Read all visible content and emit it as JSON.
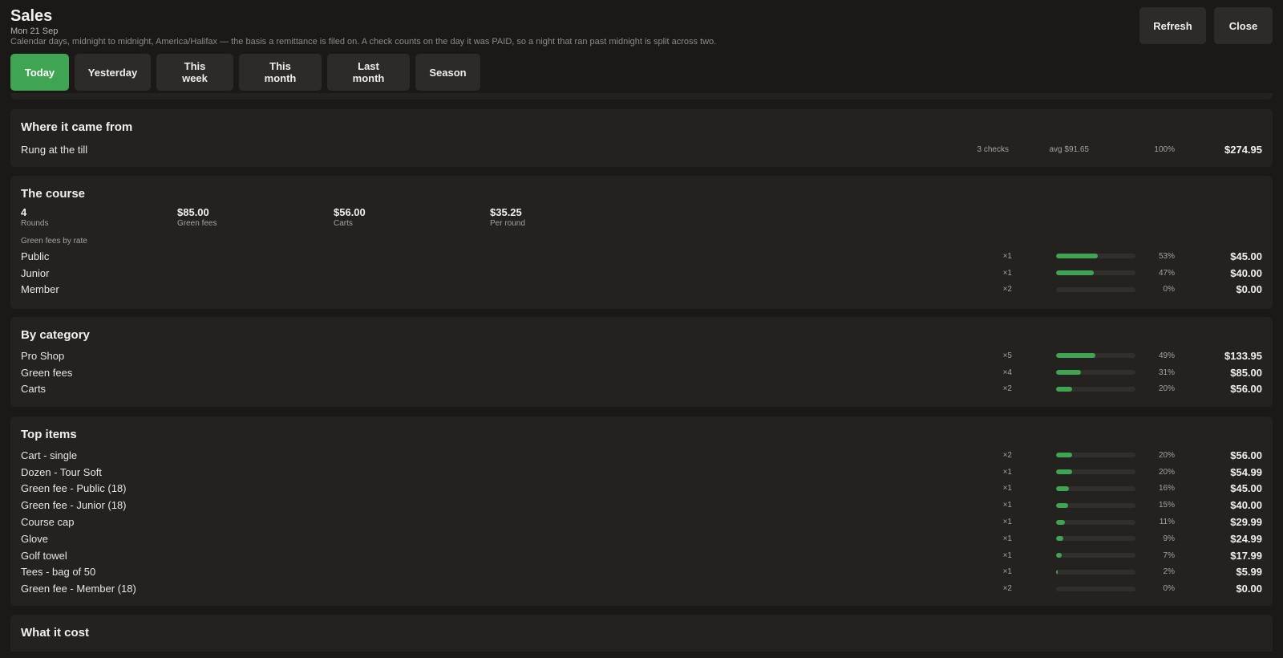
{
  "header": {
    "title": "Sales",
    "date": "Mon 21 Sep",
    "basis": "Calendar days, midnight to midnight, America/Halifax — the basis a remittance is filed on. A check counts on the day it was PAID, so a night that ran past midnight is split across two.",
    "refresh_label": "Refresh",
    "close_label": "Close"
  },
  "tabs": [
    {
      "label": "Today",
      "active": true
    },
    {
      "label": "Yesterday"
    },
    {
      "label": "This week"
    },
    {
      "label": "This month"
    },
    {
      "label": "Last month"
    },
    {
      "label": "Season"
    }
  ],
  "colors": {
    "accent": "#3fa553",
    "background": "#1a1917",
    "card": "#23221f"
  },
  "source": {
    "title": "Where it came from",
    "rows": [
      {
        "label": "Rung at the till",
        "checks": "3 checks",
        "avg": "avg $91.65",
        "pct": "100%",
        "amount": "$274.95"
      }
    ]
  },
  "course": {
    "title": "The course",
    "stats": [
      {
        "value": "4",
        "label": "Rounds"
      },
      {
        "value": "$85.00",
        "label": "Green fees"
      },
      {
        "value": "$56.00",
        "label": "Carts"
      },
      {
        "value": "$35.25",
        "label": "Per round"
      }
    ],
    "subtitle": "Green fees by rate",
    "rows": [
      {
        "label": "Public",
        "count": "×1",
        "share": 0.53,
        "pct": "53%",
        "amount": "$45.00"
      },
      {
        "label": "Junior",
        "count": "×1",
        "share": 0.47,
        "pct": "47%",
        "amount": "$40.00"
      },
      {
        "label": "Member",
        "count": "×2",
        "share": 0,
        "pct": "0%",
        "amount": "$0.00"
      }
    ]
  },
  "category": {
    "title": "By category",
    "rows": [
      {
        "label": "Pro Shop",
        "count": "×5",
        "share": 0.49,
        "pct": "49%",
        "amount": "$133.95"
      },
      {
        "label": "Green fees",
        "count": "×4",
        "share": 0.31,
        "pct": "31%",
        "amount": "$85.00"
      },
      {
        "label": "Carts",
        "count": "×2",
        "share": 0.2,
        "pct": "20%",
        "amount": "$56.00"
      }
    ]
  },
  "top_items": {
    "title": "Top items",
    "rows": [
      {
        "label": "Cart - single",
        "count": "×2",
        "share": 0.2,
        "pct": "20%",
        "amount": "$56.00"
      },
      {
        "label": "Dozen - Tour Soft",
        "count": "×1",
        "share": 0.2,
        "pct": "20%",
        "amount": "$54.99"
      },
      {
        "label": "Green fee - Public (18)",
        "count": "×1",
        "share": 0.16,
        "pct": "16%",
        "amount": "$45.00"
      },
      {
        "label": "Green fee - Junior (18)",
        "count": "×1",
        "share": 0.15,
        "pct": "15%",
        "amount": "$40.00"
      },
      {
        "label": "Course cap",
        "count": "×1",
        "share": 0.11,
        "pct": "11%",
        "amount": "$29.99"
      },
      {
        "label": "Glove",
        "count": "×1",
        "share": 0.09,
        "pct": "9%",
        "amount": "$24.99"
      },
      {
        "label": "Golf towel",
        "count": "×1",
        "share": 0.07,
        "pct": "7%",
        "amount": "$17.99"
      },
      {
        "label": "Tees - bag of 50",
        "count": "×1",
        "share": 0.02,
        "pct": "2%",
        "amount": "$5.99"
      },
      {
        "label": "Green fee - Member (18)",
        "count": "×2",
        "share": 0,
        "pct": "0%",
        "amount": "$0.00"
      }
    ]
  },
  "cost": {
    "title": "What it cost"
  }
}
